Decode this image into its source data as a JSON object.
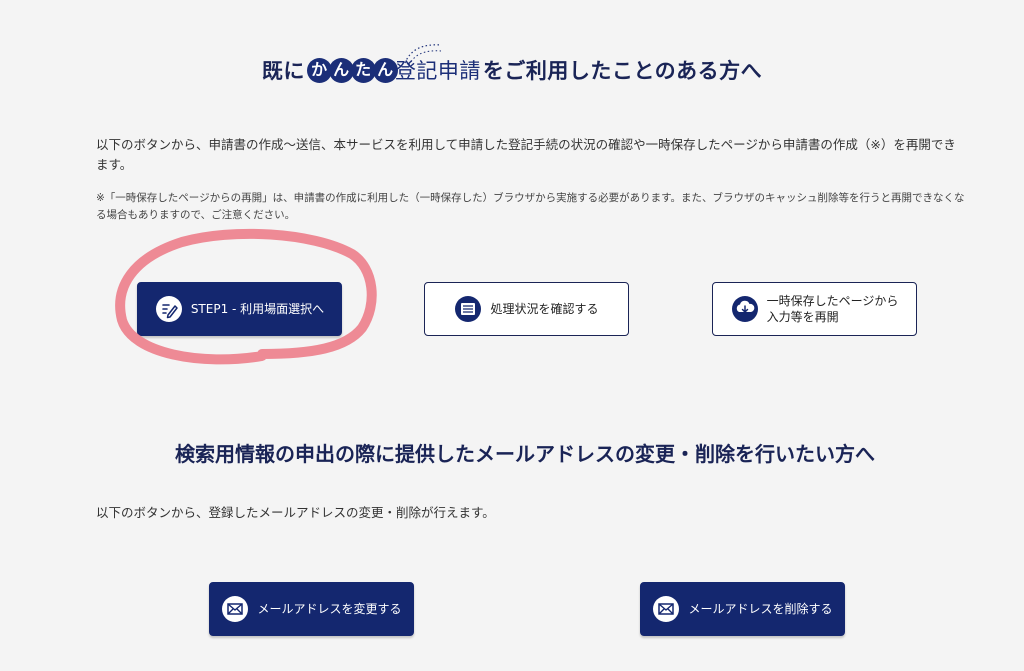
{
  "section1": {
    "title_prefix": "既に",
    "title_bubble1": "か",
    "title_bubble2": "ん",
    "title_bubble3": "た",
    "title_bubble4": "ん",
    "title_service": "登記申請",
    "title_suffix": "をご利用したことのある方へ",
    "description": "以下のボタンから、申請書の作成～送信、本サービスを利用して申請した登記手続の状況の確認や一時保存したページから申請書の作成（※）を再開できます。",
    "note": "※「一時保存したページからの再開」は、申請書の作成に利用した（一時保存した）ブラウザから実施する必要があります。また、ブラウザのキャッシュ削除等を行うと再開できなくなる場合もありますので、ご注意ください。",
    "buttons": {
      "step1": "STEP1 - 利用場面選択へ",
      "status": "処理状況を確認する",
      "resume_line1": "一時保存したページから",
      "resume_line2": "入力等を再開"
    }
  },
  "section2": {
    "title": "検索用情報の申出の際に提供したメールアドレスの変更・削除を行いたい方へ",
    "description": "以下のボタンから、登録したメールアドレスの変更・削除が行えます。",
    "buttons": {
      "change_email": "メールアドレスを変更する",
      "delete_email": "メールアドレスを削除する"
    }
  },
  "colors": {
    "primary": "#14276f",
    "heading": "#1a2456",
    "annotation": "#ee8a95",
    "background": "#f4f4f4"
  },
  "icons": [
    "pen-icon",
    "list-icon",
    "cloud-download-icon",
    "mail-icon"
  ]
}
